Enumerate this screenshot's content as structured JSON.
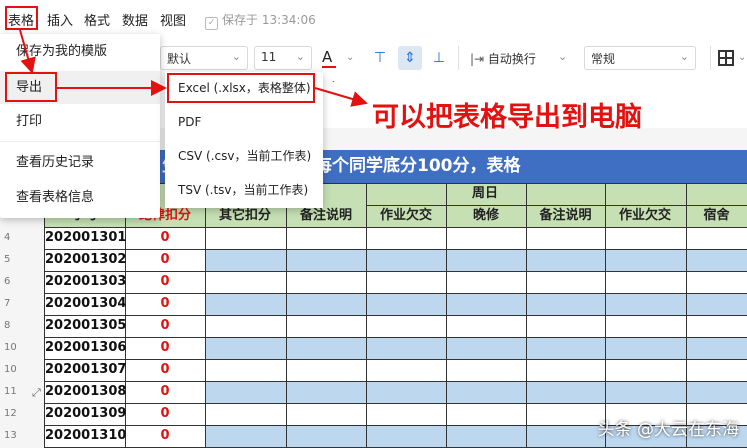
{
  "menubar": {
    "items": [
      "表格",
      "插入",
      "格式",
      "数据",
      "视图"
    ],
    "saved_text": "保存于 13:34:06"
  },
  "toolbar": {
    "font": "默认",
    "font_size": "11",
    "font_color_glyph": "A",
    "wrap": "自动换行",
    "number_format": "常规"
  },
  "menu": {
    "items": [
      "保存为我的模版",
      "导出",
      "打印",
      "查看历史记录",
      "查看表格信息"
    ]
  },
  "submenu": {
    "items": [
      "Excel (.xlsx，表格整体)",
      "PDF",
      "CSV (.csv，当前工作表)",
      "TSV (.tsv，当前工作表)"
    ]
  },
  "annotation": "可以把表格导出到电脑",
  "sheet": {
    "title": "生日常表现记录表（每个同学底分100分，表格",
    "group_header": "周日",
    "headers": [
      "学号",
      "纪律扣分",
      "其它扣分",
      "备注说明",
      "作业欠交",
      "晚修",
      "备注说明",
      "作业欠交",
      "宿舍"
    ],
    "rows": [
      {
        "num": "4",
        "id": "202001301",
        "score": "0"
      },
      {
        "num": "5",
        "id": "202001302",
        "score": "0"
      },
      {
        "num": "6",
        "id": "202001303",
        "score": "0"
      },
      {
        "num": "7",
        "id": "202001304",
        "score": "0"
      },
      {
        "num": "8",
        "id": "202001305",
        "score": "0"
      },
      {
        "num": "10",
        "id": "202001306",
        "score": "0"
      },
      {
        "num": "10",
        "id": "202001307",
        "score": "0"
      },
      {
        "num": "11",
        "id": "202001308",
        "score": "0"
      },
      {
        "num": "12",
        "id": "202001309",
        "score": "0"
      },
      {
        "num": "13",
        "id": "202001310",
        "score": "0"
      }
    ]
  },
  "colors": {
    "red": "#e3110f",
    "title_bg": "#3f6fc2",
    "header_bg": "#c6e0b4",
    "row_blue": "#bdd7ee"
  },
  "watermark": "头条 @大云在东海"
}
